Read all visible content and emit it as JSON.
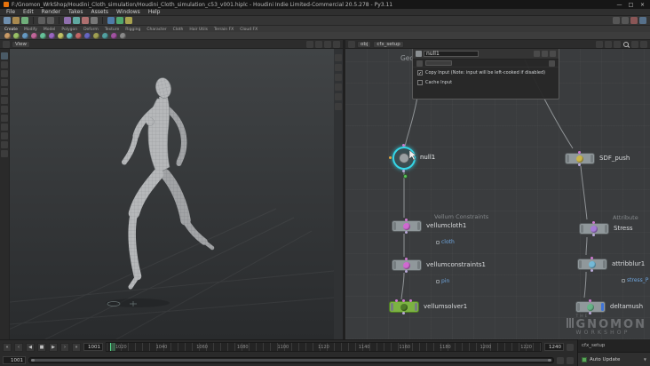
{
  "window": {
    "title": "F:/Gnomon_WrkShop/Houdini_Cloth_simulation/Houdini_Cloth_simulation_c53_v001.hiplc - Houdini Indie Limited-Commercial 20.5.278 - Py3.11",
    "minimize": "—",
    "maximize": "□",
    "close": "×"
  },
  "menu": {
    "items": [
      "File",
      "Edit",
      "Render",
      "Takes",
      "Assets",
      "Windows",
      "Help"
    ]
  },
  "shelf": {
    "tabs": [
      "Create",
      "Modify",
      "Model",
      "Polygon",
      "Deform",
      "Texture",
      "Rigging",
      "Character",
      "Cloth",
      "Hair Utils",
      "Terrain FX",
      "Cloud FX"
    ]
  },
  "viewport": {
    "header_label": "View"
  },
  "network": {
    "breadcrumb": [
      "obj",
      "cfx_setup"
    ],
    "context_label": "Geometry",
    "section_labels": {
      "vellum": "Vellum Constraints",
      "attribute": "Attribute"
    },
    "nodes": {
      "null1": {
        "name": "null1"
      },
      "vellumcloth": {
        "name": "vellumcloth1",
        "tag": "cloth"
      },
      "vellumconstraints": {
        "name": "vellumconstraints1",
        "tag": "pin"
      },
      "vellumsolver": {
        "name": "vellumsolver1"
      },
      "sdf_push": {
        "name": "SDF_push"
      },
      "stress": {
        "name": "Stress"
      },
      "attribblur": {
        "name": "attribblur1",
        "tag": "stress_P"
      },
      "deltamush": {
        "name": "deltamush"
      }
    }
  },
  "param_panel": {
    "node_name": "null1",
    "copy_input": {
      "label": "Copy Input (Note: input will be left-cooked if disabled)",
      "check": "✓"
    },
    "cache_input": {
      "label": "Cache Input"
    }
  },
  "timeline": {
    "start": "1001",
    "end": "1240",
    "current": "1001",
    "ticks": [
      "1020",
      "1040",
      "1060",
      "1080",
      "1100",
      "1120",
      "1140",
      "1160",
      "1180",
      "1200",
      "1220"
    ],
    "transport": [
      "«",
      "‹",
      "◀",
      "■",
      "▶",
      "›",
      "»"
    ]
  },
  "statusbox": {
    "pane": "cfx_setup",
    "update_mode": "Auto Update"
  },
  "watermark": {
    "the": "THE",
    "gnomon": "GNOMON",
    "workshop": "WORKSHOP"
  }
}
